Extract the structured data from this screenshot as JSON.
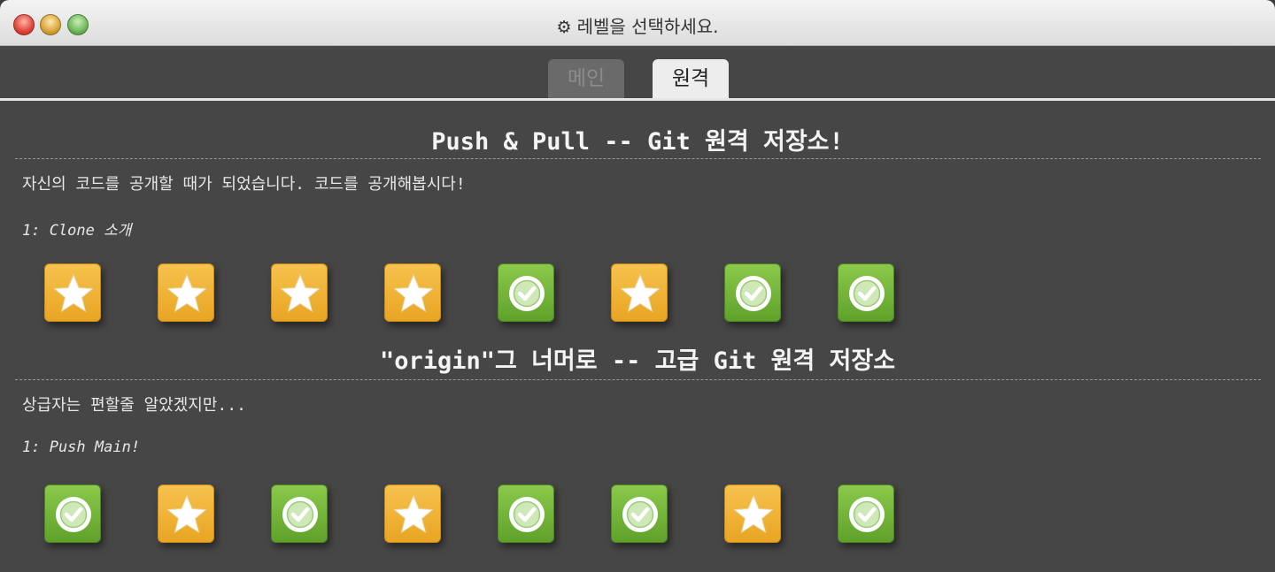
{
  "window": {
    "title": "레벨을 선택하세요."
  },
  "tabs": [
    {
      "label": "메인",
      "active": false
    },
    {
      "label": "원격",
      "active": true
    }
  ],
  "sections": [
    {
      "title": "Push & Pull -- Git 원격 저장소!",
      "description": "자신의 코드를 공개할 때가 되었습니다. 코드를 공개해봅시다!",
      "subtitle": "1: Clone 소개",
      "levels": [
        "star",
        "star",
        "star",
        "star",
        "check",
        "star",
        "check",
        "check"
      ]
    },
    {
      "title": "\"origin\"그 너머로 -- 고급 Git 원격 저장소",
      "description": "상급자는 편할줄 알았겠지만...",
      "subtitle": "1: Push Main!",
      "levels": [
        "check",
        "star",
        "check",
        "star",
        "check",
        "check",
        "star",
        "check"
      ]
    }
  ],
  "colors": {
    "star_level": "#f0b43a",
    "check_level": "#74b53a",
    "background": "#464646"
  }
}
